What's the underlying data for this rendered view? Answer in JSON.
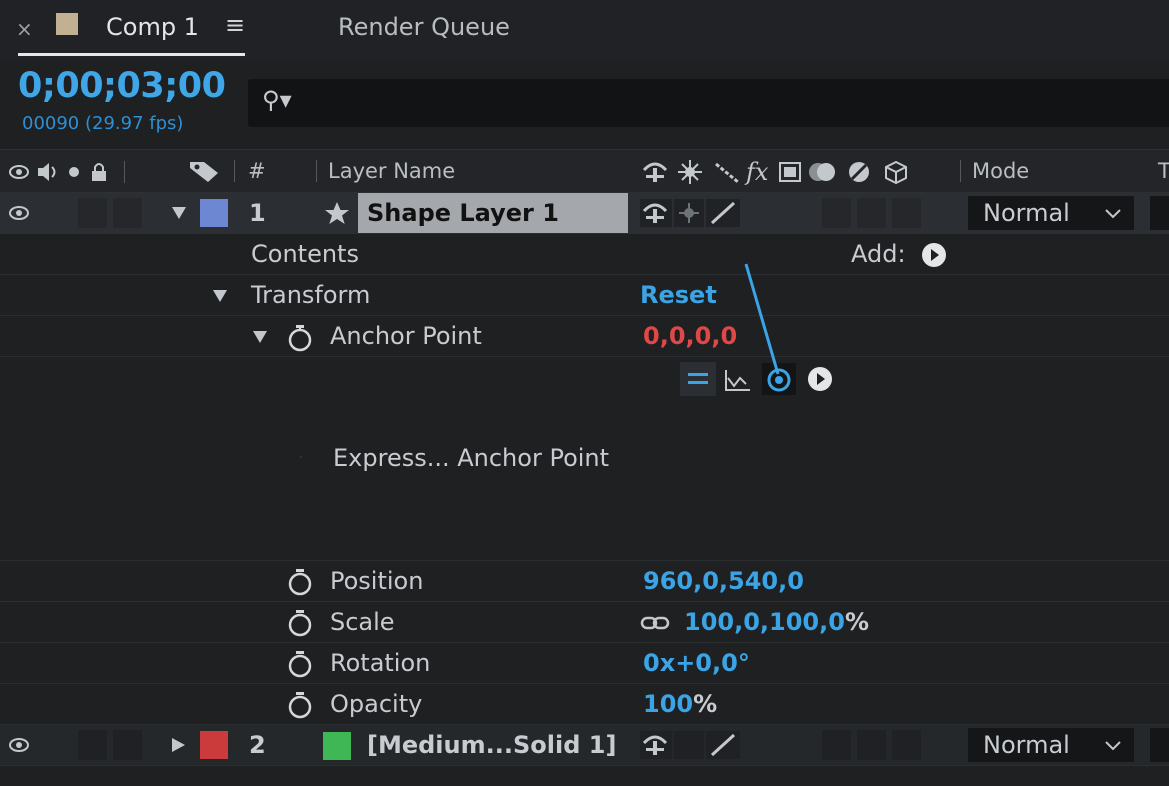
{
  "tabs": {
    "close": "×",
    "comp_title": "Comp 1",
    "menu": "≡",
    "render_queue": "Render Queue",
    "swatch_color": "#c2b092"
  },
  "timecode": {
    "time": "0;00;03;00",
    "frames": "00090 (29.97 fps)"
  },
  "search": {
    "icon": "search-icon",
    "glyph": "⚲▾",
    "placeholder": ""
  },
  "header": {
    "hash": "#",
    "layer_name": "Layer Name",
    "mode": "Mode",
    "overflow": "T",
    "fx": "fx"
  },
  "layers": [
    {
      "number": "1",
      "name": "Shape Layer 1",
      "label_color": "#6d87d3",
      "mode": "Normal"
    },
    {
      "number": "2",
      "name": "[Medium...Solid 1]",
      "label_color": "#cc3b3b",
      "swatch_color": "#3fb755",
      "mode": "Normal"
    }
  ],
  "properties": {
    "contents": "Contents",
    "add": "Add:",
    "transform": "Transform",
    "reset": "Reset",
    "anchor_point": "Anchor Point",
    "anchor_value": "0,0,0,0",
    "expression_label": "Express... Anchor Point",
    "position": "Position",
    "position_value": "960,0,540,0",
    "scale": "Scale",
    "scale_value_num": "100,0,100,0",
    "scale_value_unit": "%",
    "rotation": "Rotation",
    "rotation_value_turns": "0x",
    "rotation_value_deg": "+0,0°",
    "opacity": "Opacity",
    "opacity_value_num": "100",
    "opacity_value_unit": "%"
  },
  "colors": {
    "accent_blue": "#3aa4e6",
    "keyframed_red": "#e04848",
    "panel_bg": "#1e2022"
  }
}
